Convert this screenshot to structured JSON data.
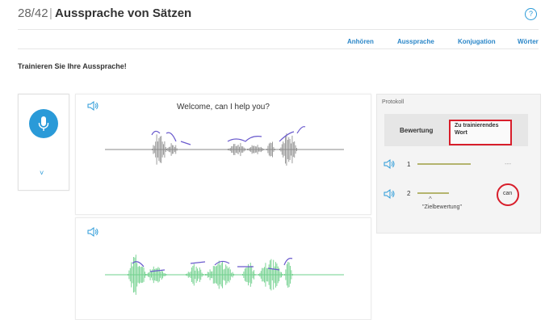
{
  "header": {
    "counter": "28/42",
    "separator": "|",
    "title": "Aussprache von Sätzen",
    "help_icon": "?"
  },
  "tabs": [
    {
      "label": "Anhören"
    },
    {
      "label": "Aussprache"
    },
    {
      "label": "Konjugation"
    },
    {
      "label": "Wörter"
    }
  ],
  "section_title": "Trainieren Sie Ihre Aussprache!",
  "mic_panel": {
    "mic_icon": "microphone-icon",
    "expand_icon": "chevron-down-icon",
    "expand_glyph": "˅"
  },
  "reference": {
    "sentence": "Welcome, can I help you?",
    "speaker_icon": "speaker-icon"
  },
  "user_recording": {
    "speaker_icon": "speaker-icon"
  },
  "protocol": {
    "title": "Protokoll",
    "columns": {
      "bewertung": "Bewertung",
      "trainieren": "Zu trainierendes Wort"
    },
    "rows": [
      {
        "number": "1",
        "score": 0.6,
        "word": "---"
      },
      {
        "number": "2",
        "score": 0.35,
        "caret": "^",
        "note": "\"Zielbewertung\"",
        "word": "can"
      }
    ]
  },
  "colors": {
    "accent": "#2a9ad8",
    "highlight_red": "#d81e2b",
    "reference_wave": "#8a8a8a",
    "user_wave": "#6fd08c",
    "pitch_line": "#6a5acd",
    "score_bar": "#b4b46e"
  }
}
